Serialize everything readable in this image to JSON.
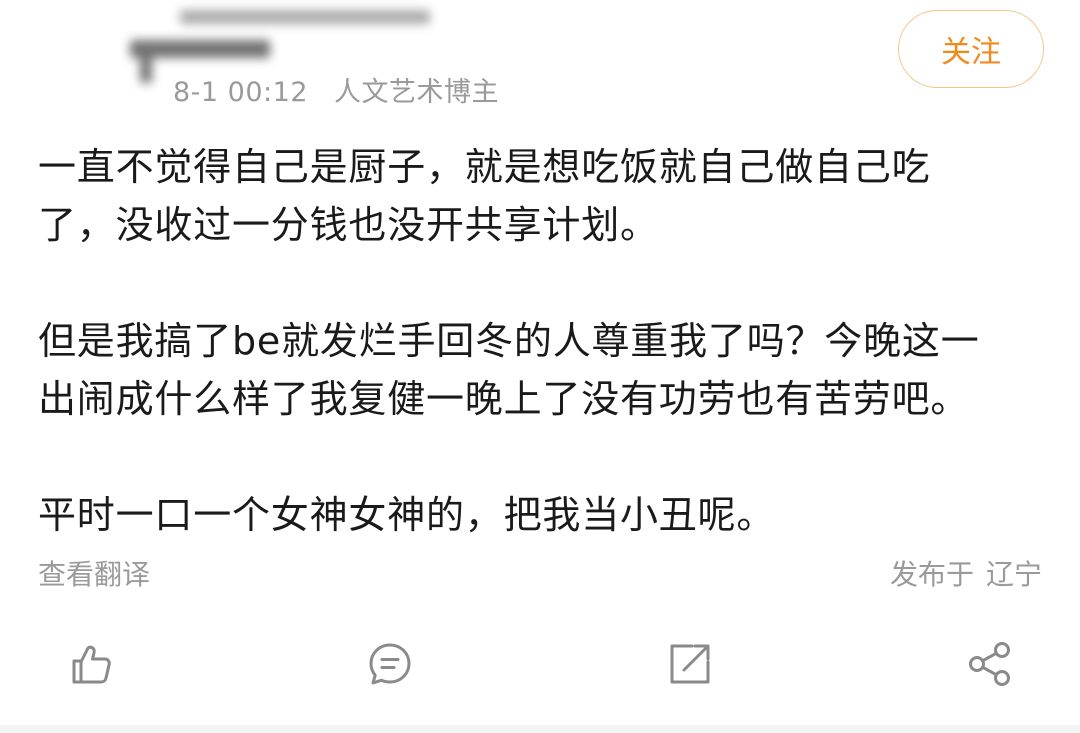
{
  "post": {
    "meta": {
      "time": "8-1 00:12",
      "source": "人文艺术博主"
    },
    "follow_label": "关注",
    "paragraphs": [
      [
        "一直不觉得自己是厨子，就是想吃饭就自己做自己吃",
        "了，没收过一分钱也没开共享计划。"
      ],
      [
        "但是我搞了be就发烂手回冬的人尊重我了吗？今晚这一",
        "出闹成什么样了我复健一晚上了没有功劳也有苦劳吧。"
      ],
      [
        "平时一口一个女神女神的，把我当小丑呢。"
      ]
    ],
    "translate_label": "查看翻译",
    "location_prefix": "发布于",
    "location_value": "辽宁"
  },
  "actions": {
    "icons": [
      "like-icon",
      "comment-icon",
      "repost-icon",
      "share-icon"
    ]
  },
  "colors": {
    "accent": "#f08a1c",
    "accent_border": "#f5c68a",
    "meta_gray": "#9a9a9a",
    "icon_gray": "#8a8a8a"
  }
}
